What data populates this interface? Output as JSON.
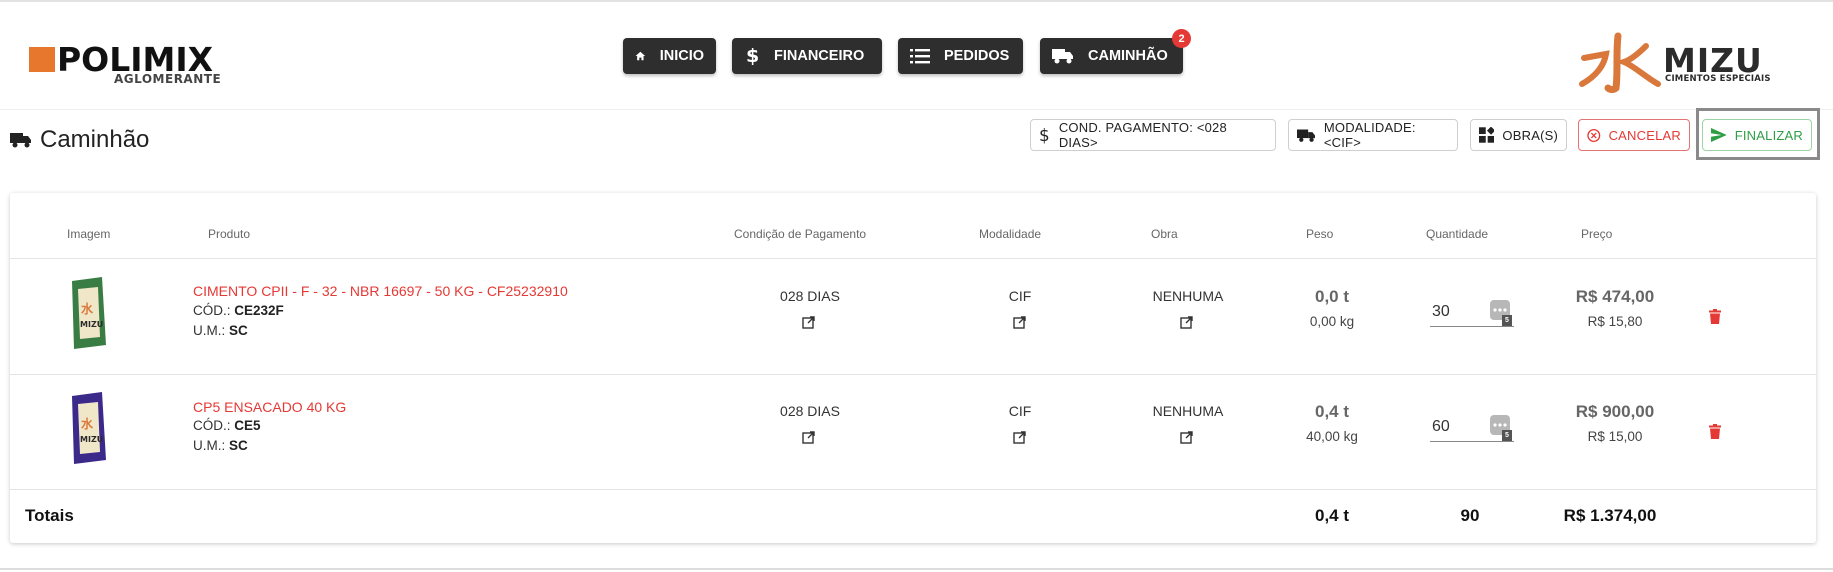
{
  "header": {
    "left_logo": {
      "brand": "POLIMIX",
      "sub": "AGLOMERANTE"
    },
    "right_logo": {
      "brand": "MIZU",
      "tag": "CIMENTOS ESPECIAIS"
    },
    "nav": [
      {
        "label": "INICIO",
        "icon": "home-icon"
      },
      {
        "label": "FINANCEIRO",
        "icon": "dollar-icon"
      },
      {
        "label": "PEDIDOS",
        "icon": "list-icon"
      },
      {
        "label": "CAMINHÃO",
        "icon": "truck-icon"
      }
    ],
    "cart_badge": "2"
  },
  "title": "Caminhão",
  "actions": {
    "cond_pagamento": "COND. PAGAMENTO: <028 DIAS>",
    "modalidade": "MODALIDADE: <CIF>",
    "obras": "OBRA(S)",
    "cancelar": "CANCELAR",
    "finalizar": "FINALIZAR"
  },
  "table": {
    "headers": [
      "Imagem",
      "Produto",
      "Condição de Pagamento",
      "Modalidade",
      "Obra",
      "Peso",
      "Quantidade",
      "Preço"
    ],
    "rows": [
      {
        "produto": "CIMENTO CPII - F - 32 - NBR 16697 - 50 KG - CF25232910",
        "cod_label": "CÓD.:",
        "cod": "CE232F",
        "um_label": "U.M.:",
        "um": "SC",
        "condicao": "028 DIAS",
        "modalidade": "CIF",
        "obra": "NENHUMA",
        "peso_t": "0,0 t",
        "peso_kg": "0,00 kg",
        "quantidade": "30",
        "preco_total": "R$ 474,00",
        "preco_unit": "R$ 15,80",
        "bag_color": "#3a7d44"
      },
      {
        "produto": "CP5 ENSACADO 40 KG",
        "cod_label": "CÓD.:",
        "cod": "CE5",
        "um_label": "U.M.:",
        "um": "SC",
        "condicao": "028 DIAS",
        "modalidade": "CIF",
        "obra": "NENHUMA",
        "peso_t": "0,4 t",
        "peso_kg": "40,00 kg",
        "quantidade": "60",
        "preco_total": "R$ 900,00",
        "preco_unit": "R$ 15,00",
        "bag_color": "#3b2a8a"
      }
    ],
    "totals": {
      "label": "Totais",
      "peso": "0,4 t",
      "quantidade": "90",
      "preco": "R$ 1.374,00"
    }
  },
  "colors": {
    "accent_red": "#e53935",
    "accent_green": "#2e9e44",
    "nav_bg": "#2e2e2e",
    "polimix_orange": "#e8772e",
    "mizu_orange": "#d9783a"
  }
}
